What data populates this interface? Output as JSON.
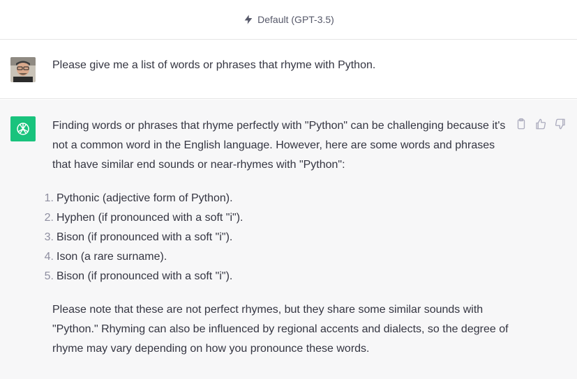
{
  "header": {
    "model_label": "Default (GPT-3.5)"
  },
  "user_message": {
    "text": "Please give me a list of words or phrases that rhyme with Python."
  },
  "assistant_message": {
    "intro": "Finding words or phrases that rhyme perfectly with \"Python\" can be challenging because it's not a common word in the English language. However, here are some words and phrases that have similar end sounds or near-rhymes with \"Python\":",
    "items": [
      {
        "num": "1.",
        "text": "Pythonic (adjective form of Python)."
      },
      {
        "num": "2.",
        "text": "Hyphen (if pronounced with a soft \"i\")."
      },
      {
        "num": "3.",
        "text": "Bison (if pronounced with a soft \"i\")."
      },
      {
        "num": "4.",
        "text": "Ison (a rare surname)."
      },
      {
        "num": "5.",
        "text": "Bison (if pronounced with a soft \"i\")."
      }
    ],
    "outro": "Please note that these are not perfect rhymes, but they share some similar sounds with \"Python.\" Rhyming can also be influenced by regional accents and dialects, so the degree of rhyme may vary depending on how you pronounce these words."
  },
  "icons": {
    "model": "bolt-icon",
    "copy": "clipboard-icon",
    "like": "thumbs-up-icon",
    "dislike": "thumbs-down-icon",
    "assistant": "openai-logo-icon"
  },
  "colors": {
    "assistant_avatar": "#19c37d",
    "assistant_bg": "#f7f7f8",
    "text": "#343541",
    "muted": "#8e8ea0"
  }
}
